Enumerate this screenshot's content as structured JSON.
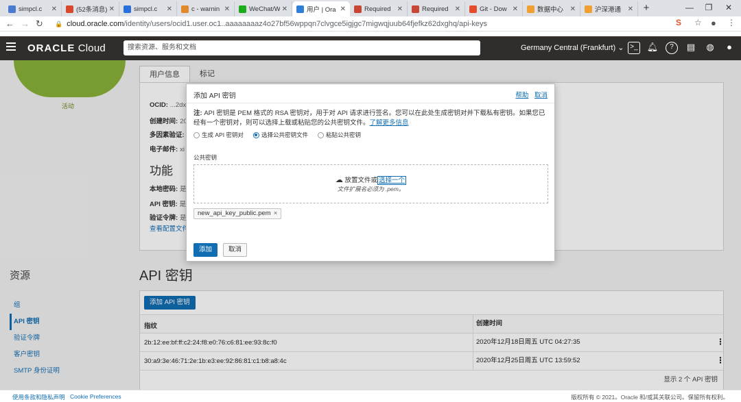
{
  "browser": {
    "tabs": [
      {
        "label": "simpcl.c",
        "color": "#4a7bd0"
      },
      {
        "label": "(52条消息)",
        "color": "#d9482b"
      },
      {
        "label": "simpcl.c",
        "color": "#2a6fdb"
      },
      {
        "label": "c - warnin",
        "color": "#e08a2c"
      },
      {
        "label": "WeChat/W",
        "color": "#1aad19"
      },
      {
        "label": "用户 | Ora",
        "color": "#2f7ed8"
      },
      {
        "label": "Required",
        "color": "#c74634"
      },
      {
        "label": "Required",
        "color": "#c74634"
      },
      {
        "label": "Git - Dow",
        "color": "#e44c2c"
      },
      {
        "label": "数据中心",
        "color": "#f0a030"
      },
      {
        "label": "沪深港通",
        "color": "#f0a030"
      }
    ],
    "active_tab": 5,
    "url_host": "cloud.oracle.com",
    "url_path": "/identity/users/ocid1.user.oc1..aaaaaaaaz4o27bf56wppqn7clvgce5igjgc7migwqjuub64fjefkz62dxghq/api-keys"
  },
  "oracle_header": {
    "logo_brand": "ORACLE",
    "logo_product": "Cloud",
    "search_placeholder": "搜索资源、服务和文档",
    "region": "Germany Central (Frankfurt)"
  },
  "user_page": {
    "status": "活动",
    "tabs": [
      "用户信息",
      "标记"
    ],
    "info": [
      {
        "label": "OCID:",
        "value": "...2dx"
      },
      {
        "label": "创建时间:",
        "value": "20"
      },
      {
        "label": "多因素验证:",
        "value": ""
      },
      {
        "label": "电子邮件:",
        "value": "xi"
      }
    ],
    "features_title": "功能",
    "features": [
      {
        "label": "本地密码:",
        "value": "是"
      },
      {
        "label": "API 密钥:",
        "value": "是"
      },
      {
        "label": "验证令牌:",
        "value": "是"
      }
    ],
    "config_link": "查看配置文件"
  },
  "resources": {
    "title": "资源",
    "items": [
      "组",
      "API 密钥",
      "验证令牌",
      "客户密钥",
      "SMTP 身份证明"
    ],
    "active": 1
  },
  "api_keys": {
    "title": "API 密钥",
    "add_button": "添加 API 密钥",
    "columns": [
      "指纹",
      "创建时间"
    ],
    "rows": [
      {
        "fingerprint": "2b:12:ee:bf:ff:c2:24:f8:e0:76:c6:81:ee:93:8c:f0",
        "created": "2020年12月18日周五 UTC 04:27:35"
      },
      {
        "fingerprint": "30:a9:3e:46:71:2e:1b:e3:ee:92:86:81:c1:b8:a8:4c",
        "created": "2020年12月25日周五 UTC 13:59:52"
      }
    ],
    "footer": "显示 2 个 API 密钥"
  },
  "footer": {
    "terms": "使用条款和隐私声明",
    "cookies": "Cookie Preferences",
    "copyright": "版权所有 © 2021。Oracle 和/或其关联公司。保留所有权利。"
  },
  "modal": {
    "title": "添加 API 密钥",
    "help": "帮助",
    "cancel_link": "取消",
    "note_label": "注:",
    "note_text": "API 密钥是 PEM 格式的 RSA 密钥对，用于对 API 请求进行签名。您可以在此处生成密钥对并下载私有密钥。如果您已经有一个密钥对，则可以选择上载或粘贴您的公共密钥文件。",
    "note_link": "了解更多信息",
    "radio_options": [
      "生成 API 密钥对",
      "选择公共密钥文件",
      "粘贴公共密钥"
    ],
    "radio_selected": 1,
    "public_key_label": "公共密钥",
    "drop_text": "放置文件或",
    "drop_link": "选择一个",
    "drop_hint": "文件扩展名必须为 .pem。",
    "file_chip": "new_api_key_public.pem",
    "add_button": "添加",
    "cancel_button": "取消"
  }
}
